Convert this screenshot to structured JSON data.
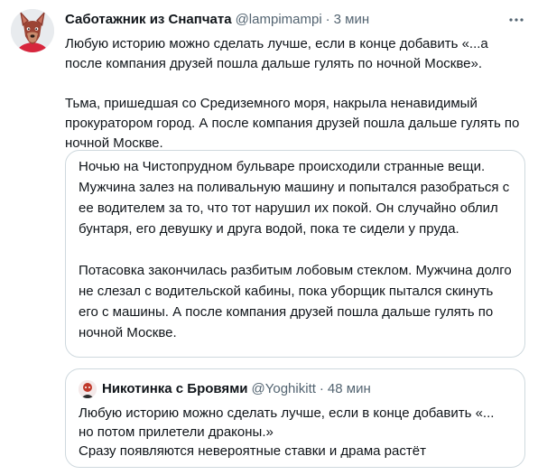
{
  "tweet": {
    "author_name": "Саботажник из Снапчата",
    "handle": "@lampimampi",
    "separator": "·",
    "time": "3 мин",
    "text_lines": [
      "Любую историю можно сделать лучше, если в конце добавить «...а после компания друзей пошла дальше гулять по ночной Москве».",
      "Тьма, пришедшая со Средиземного моря, накрыла ненавидимый прокуратором город. А после компания друзей пошла дальше гулять по ночной Москве."
    ],
    "more_icon": "more-horizontal-icon"
  },
  "card": {
    "paragraphs": [
      "Ночью на Чистопрудном бульваре происходили странные вещи. Мужчина залез на поливальную машину и попытался разобраться с ее водителем за то, что тот нарушил их покой. Он случайно облил бунтаря, его девушку и друга водой, пока те сидели у пруда.",
      "Потасовка закончилась разбитым лобовым стеклом. Мужчина долго не слезал с водительской кабины, пока уборщик пытался скинуть его с машины. А после компания друзей пошла дальше гулять по ночной Москве."
    ]
  },
  "quote": {
    "author_name": "Никотинка с Бровями",
    "handle": "@Yoghikitt",
    "separator": "·",
    "time": "48 мин",
    "text": "Любую историю можно сделать лучше, если в конце добавить «... но потом прилетели драконы.»\nСразу появляются невероятные ставки и драма растёт"
  },
  "colors": {
    "text": "#0f1419",
    "secondary": "#536471",
    "border": "#cfd9de"
  }
}
